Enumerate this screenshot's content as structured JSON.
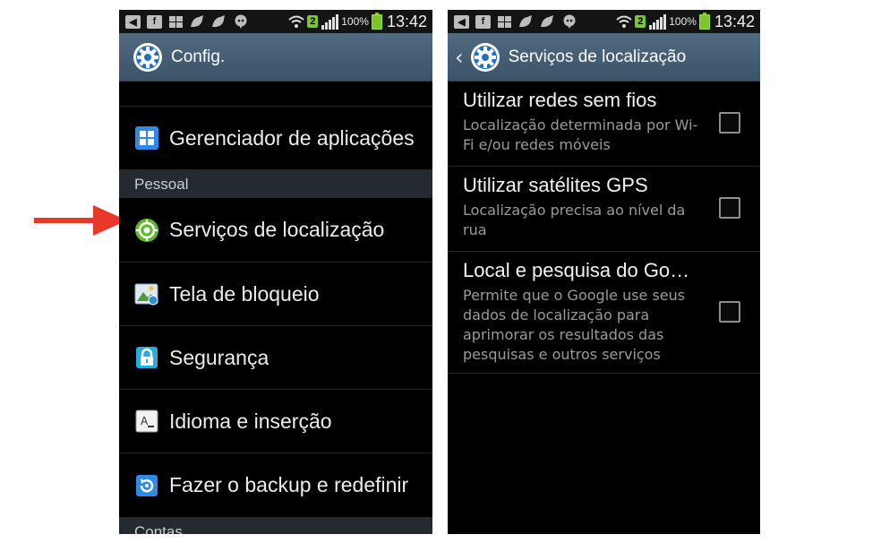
{
  "status_bar": {
    "battery_percent": "100%",
    "time": "13:42",
    "notification_count": "2",
    "icons": [
      "back-icon",
      "facebook-icon",
      "windows-icon",
      "bird-icon",
      "bird-icon",
      "hangouts-icon",
      "wifi-icon"
    ]
  },
  "left_screen": {
    "title": "Config.",
    "items": [
      {
        "label": "Gerenciador de aplicações",
        "icon": "apps-grid-icon"
      },
      {
        "label": "Serviços de localização",
        "icon": "location-icon"
      },
      {
        "label": "Tela de bloqueio",
        "icon": "lock-screen-icon"
      },
      {
        "label": "Segurança",
        "icon": "padlock-icon"
      },
      {
        "label": "Idioma e inserção",
        "icon": "keyboard-icon"
      },
      {
        "label": "Fazer o backup e redefinir",
        "icon": "backup-icon"
      }
    ],
    "sections": {
      "personal": "Pessoal",
      "accounts": "Contas"
    }
  },
  "right_screen": {
    "title": "Serviços de localização",
    "items": [
      {
        "title": "Utilizar redes sem fios",
        "subtitle": "Localização determinada por Wi-Fi e/ou redes móveis",
        "checked": false
      },
      {
        "title": "Utilizar satélites GPS",
        "subtitle": "Localização precisa ao nível da rua",
        "checked": false
      },
      {
        "title": "Local e pesquisa do Go…",
        "subtitle": "Permite que o Google use seus dados de localização para aprimorar os resultados das pesquisas e outros serviços",
        "checked": false
      }
    ]
  },
  "colors": {
    "arrow": "#e8382a",
    "action_bar": "#46607a",
    "section": "#252a30"
  }
}
